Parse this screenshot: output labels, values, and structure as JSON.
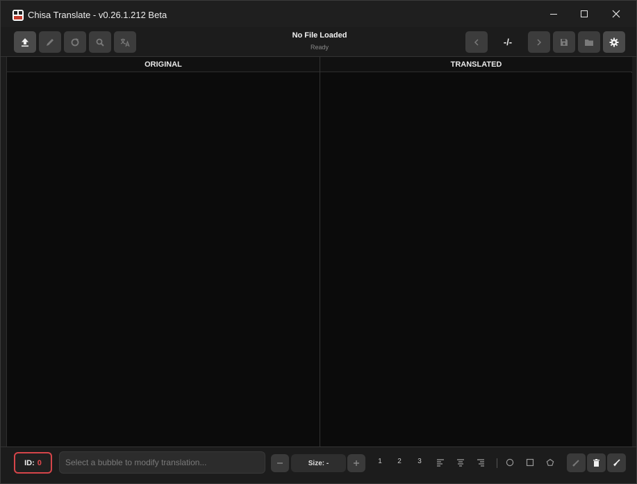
{
  "window": {
    "title": "Chisa Translate - v0.26.1.212 Beta"
  },
  "toolbar": {
    "file_status": "No File Loaded",
    "sub_status": "Ready",
    "page_counter": "-/-"
  },
  "panels": {
    "left_header": "ORIGINAL",
    "right_header": "TRANSLATED"
  },
  "bottom": {
    "id_label": "ID:",
    "id_value": "0",
    "translation_placeholder": "Select a bubble to modify translation...",
    "size_label": "Size: -",
    "preset_1": "1",
    "preset_2": "2",
    "preset_3": "3"
  },
  "icons": {
    "upload": "upload-icon",
    "edit": "pencil-icon",
    "refresh": "refresh-icon",
    "search": "search-icon",
    "translate": "translate-icon",
    "prev": "chevron-left-icon",
    "next": "chevron-right-icon",
    "save": "save-icon",
    "folder": "folder-icon",
    "settings": "gear-icon",
    "brush": "brush-icon",
    "delete": "trash-icon",
    "clean": "broom-icon"
  },
  "colors": {
    "accent_red": "#e5484d",
    "background": "#1c1c1c",
    "panel_bg": "#0b0b0b"
  }
}
